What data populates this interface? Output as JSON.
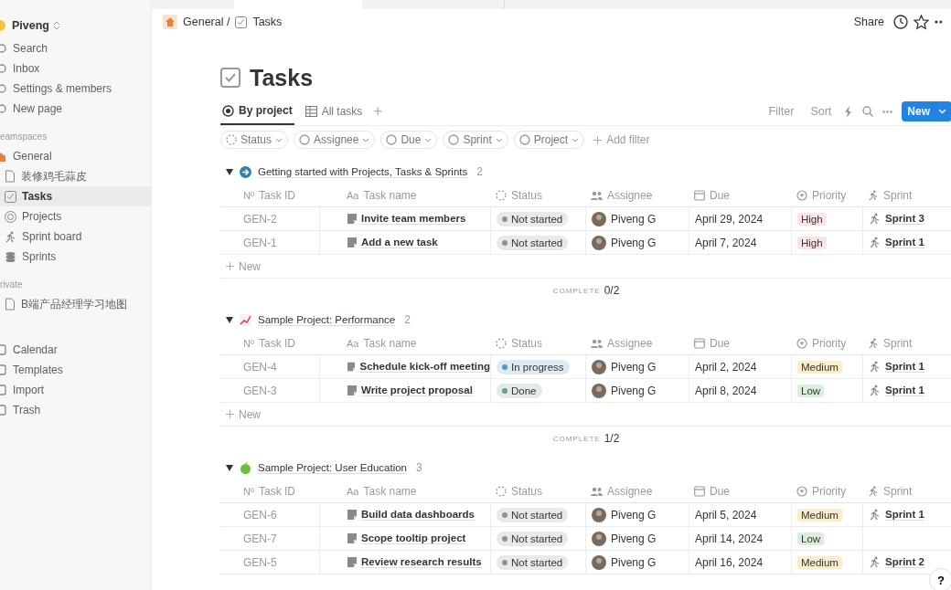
{
  "sidebar": {
    "workspace": "Piveng",
    "top_items": [
      {
        "label": "Search"
      },
      {
        "label": "Inbox"
      },
      {
        "label": "Settings & members"
      },
      {
        "label": "New page"
      }
    ],
    "sections": [
      {
        "title": "eamspaces",
        "items": [
          {
            "label": "General",
            "selected": false,
            "children": [
              {
                "label": "装修鸡毛蒜皮",
                "selected": false
              },
              {
                "label": "Tasks",
                "selected": true
              },
              {
                "label": "Projects",
                "selected": false
              },
              {
                "label": "Sprint board",
                "selected": false
              },
              {
                "label": "Sprints",
                "selected": false
              }
            ]
          }
        ]
      },
      {
        "title": "rivate",
        "items": [
          {
            "label": "B端产品经理学习地图",
            "selected": false
          }
        ]
      }
    ],
    "bottom_items": [
      {
        "label": "Calendar"
      },
      {
        "label": "Templates"
      },
      {
        "label": "Import"
      },
      {
        "label": "Trash"
      }
    ]
  },
  "breadcrumb": [
    "General /",
    "Tasks"
  ],
  "header_actions": {
    "share": "Share"
  },
  "title": "Tasks",
  "views": [
    {
      "label": "By project",
      "selected": true
    },
    {
      "label": "All tasks",
      "selected": false
    }
  ],
  "view_add": "+",
  "toolbar": {
    "filter": "Filter",
    "sort": "Sort",
    "new": "New"
  },
  "filters": [
    "Status",
    "Assignee",
    "Due",
    "Sprint",
    "Project"
  ],
  "add_filter": "Add filter",
  "groups": [
    {
      "name": "Getting started with Projects, Tasks & Sprints",
      "count": "2",
      "complete_label": "COMPLETE",
      "complete": "0/2",
      "new_label": "New",
      "columns": [
        {
          "prefix": "Nº",
          "label": "Task ID"
        },
        {
          "prefix": "Aa",
          "label": "Task name"
        },
        {
          "label": "Status"
        },
        {
          "label": "Assignee"
        },
        {
          "label": "Due"
        },
        {
          "label": "Priority"
        },
        {
          "label": "Sprint"
        }
      ],
      "rows": [
        {
          "id": "GEN-2",
          "name": "Invite team members",
          "status": {
            "label": "Not started",
            "color": "#91918e"
          },
          "assignee": "Piveng G",
          "due": "April 29, 2024",
          "priority": {
            "label": "High",
            "color": "#fbe4e4"
          },
          "sprint": "Sprint 3"
        },
        {
          "id": "GEN-1",
          "name": "Add a new task",
          "status": {
            "label": "Not started",
            "color": "#91918e"
          },
          "assignee": "Piveng G",
          "due": "April 7, 2024",
          "priority": {
            "label": "High",
            "color": "#fbe4e4"
          },
          "sprint": "Sprint 1"
        }
      ]
    },
    {
      "name": "Sample Project: Performance",
      "count": "2",
      "complete_label": "COMPLETE",
      "complete": "1/2",
      "new_label": "New",
      "columns": [
        {
          "prefix": "Nº",
          "label": "Task ID"
        },
        {
          "prefix": "Aa",
          "label": "Task name"
        },
        {
          "label": "Status"
        },
        {
          "label": "Assignee"
        },
        {
          "label": "Due"
        },
        {
          "label": "Priority"
        },
        {
          "label": "Sprint"
        }
      ],
      "rows": [
        {
          "id": "GEN-4",
          "name": "Schedule kick-off meeting",
          "status": {
            "label": "In progress",
            "color": "#5b97bd"
          },
          "assignee": "Piveng G",
          "due": "April 2, 2024",
          "priority": {
            "label": "Medium",
            "color": "#fbeccc"
          },
          "sprint": "Sprint 1"
        },
        {
          "id": "GEN-3",
          "name": "Write project proposal",
          "status": {
            "label": "Done",
            "color": "#6c9b7d"
          },
          "assignee": "Piveng G",
          "due": "April 8, 2024",
          "priority": {
            "label": "Low",
            "color": "#dbeddb"
          },
          "sprint": "Sprint 1"
        }
      ]
    },
    {
      "name": "Sample Project: User Education",
      "count": "3",
      "columns": [
        {
          "prefix": "Nº",
          "label": "Task ID"
        },
        {
          "prefix": "Aa",
          "label": "Task name"
        },
        {
          "label": "Status"
        },
        {
          "label": "Assignee"
        },
        {
          "label": "Due"
        },
        {
          "label": "Priority"
        },
        {
          "label": "Sprint"
        }
      ],
      "rows": [
        {
          "id": "GEN-6",
          "name": "Build data dashboards",
          "status": {
            "label": "Not started",
            "color": "#91918e"
          },
          "assignee": "Piveng G",
          "due": "April 5, 2024",
          "priority": {
            "label": "Medium",
            "color": "#fbeccc"
          },
          "sprint": "Sprint 1"
        },
        {
          "id": "GEN-7",
          "name": "Scope tooltip project",
          "status": {
            "label": "Not started",
            "color": "#91918e"
          },
          "assignee": "Piveng G",
          "due": "April 14, 2024",
          "priority": {
            "label": "Low",
            "color": "#dbeddb"
          }
        },
        {
          "id": "GEN-5",
          "name": "Review research results",
          "status": {
            "label": "Not started",
            "color": "#91918e"
          },
          "assignee": "Piveng G",
          "due": "April 16, 2024",
          "priority": {
            "label": "Medium",
            "color": "#fbeccc"
          },
          "sprint": "Sprint 2"
        }
      ]
    }
  ],
  "help": "?"
}
